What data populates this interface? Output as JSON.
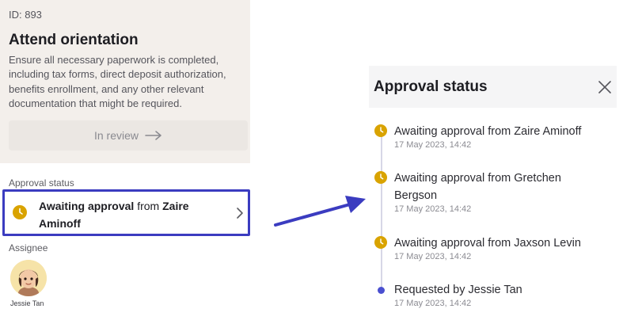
{
  "task": {
    "id": "ID: 893",
    "title": "Attend orientation",
    "description": "Ensure all necessary paperwork is completed, including tax forms, direct deposit authorization, benefits enrollment, and any other relevant documentation that might be required.",
    "status_button": "In review"
  },
  "approval": {
    "section_label": "Approval status",
    "bold_prefix": "Awaiting approval",
    "connector": " from ",
    "approver": "Zaire Aminoff"
  },
  "assignee": {
    "section_label": "Assignee",
    "name": "Jessie Tan"
  },
  "panel": {
    "title": "Approval status",
    "items": [
      {
        "text": "Awaiting approval from Zaire Aminoff",
        "time": "17 May 2023, 14:42",
        "icon": "clock-icon"
      },
      {
        "text": "Awaiting approval from Gretchen Bergson",
        "time": "17 May 2023, 14:42",
        "icon": "clock-icon"
      },
      {
        "text": "Awaiting approval from Jaxson Levin",
        "time": "17 May 2023, 14:42",
        "icon": "clock-icon"
      },
      {
        "text": "Requested by Jessie Tan",
        "time": "17 May 2023, 14:42",
        "icon": "dot-icon"
      }
    ]
  },
  "colors": {
    "accent": "#3b3cc0",
    "pending": "#d9a300",
    "requested_dot": "#4a4fd0",
    "task_background": "#f3efeb"
  }
}
